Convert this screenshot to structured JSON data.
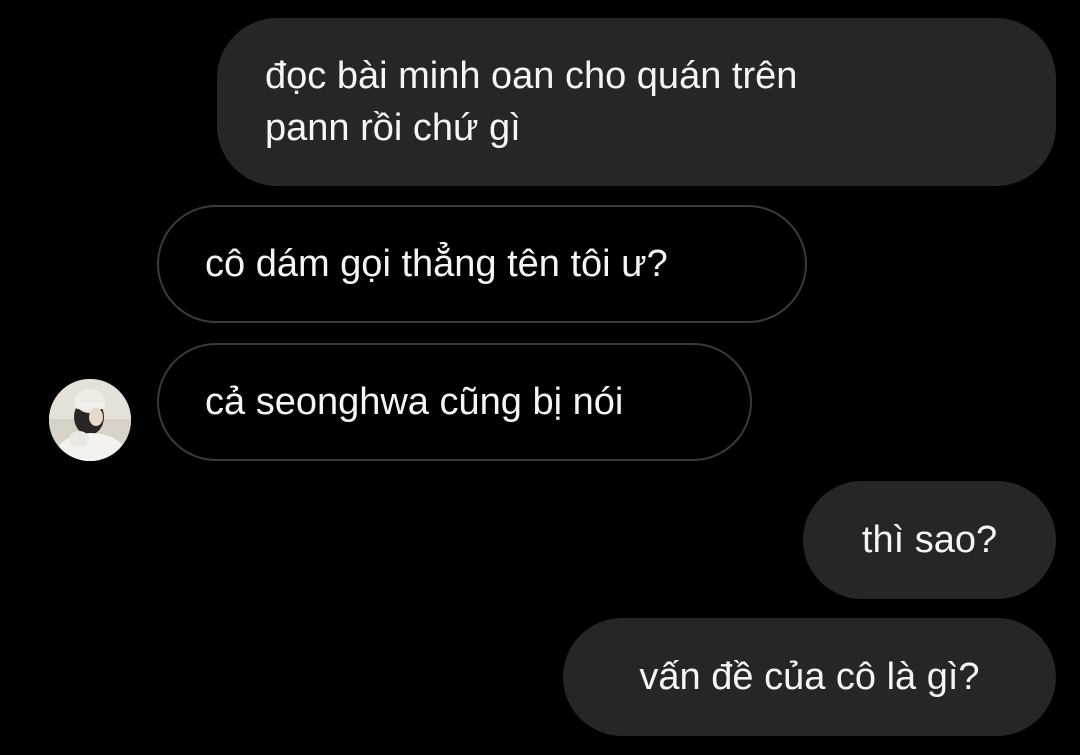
{
  "conversation": {
    "messages": [
      {
        "direction": "outgoing",
        "text": "đọc bài minh oan cho quán trên\npann rồi chứ gì"
      },
      {
        "direction": "incoming",
        "text": "cô dám gọi thẳng tên tôi ư?"
      },
      {
        "direction": "incoming",
        "text": "cả seonghwa cũng bị nói"
      },
      {
        "direction": "outgoing",
        "text": "thì sao?"
      },
      {
        "direction": "outgoing",
        "text": "vấn đề của cô là gì?"
      }
    ]
  },
  "colors": {
    "background": "#000000",
    "outgoing_bubble": "#262626",
    "incoming_border": "#3a3a3a",
    "text": "#f5f5f5"
  },
  "icons": {
    "avatar": "contact-avatar-photo"
  }
}
